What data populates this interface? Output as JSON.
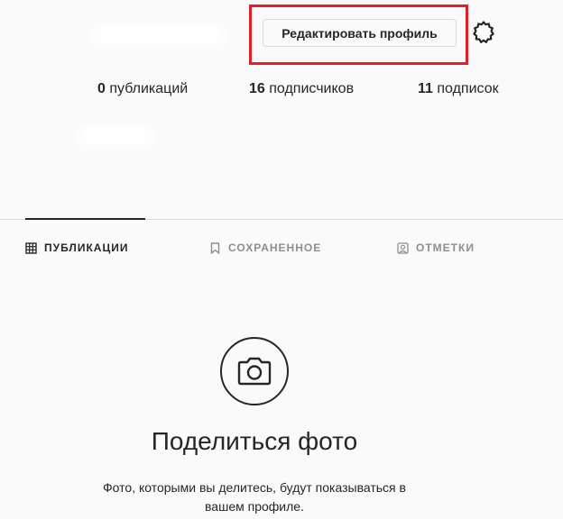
{
  "profile": {
    "edit_button_label": "Редактировать профиль",
    "settings_icon": "gear-icon",
    "stats": [
      {
        "count": "0",
        "label": "публикаций"
      },
      {
        "count": "16",
        "label": "подписчиков"
      },
      {
        "count": "11",
        "label": "подписок"
      }
    ]
  },
  "tabs": [
    {
      "label": "ПУБЛИКАЦИИ",
      "icon": "grid-icon",
      "active": true
    },
    {
      "label": "СОХРАНЕННОЕ",
      "icon": "bookmark-icon",
      "active": false
    },
    {
      "label": "ОТМЕТКИ",
      "icon": "tagged-user-icon",
      "active": false
    }
  ],
  "empty_state": {
    "icon": "camera-icon",
    "title": "Поделиться фото",
    "description_line1": "Фото, которыми вы делитесь, будут показываться в",
    "description_line2": "вашем профиле."
  },
  "colors": {
    "background": "#fafafa",
    "text": "#262626",
    "muted": "#8e8e8e",
    "border": "#dbdbdb",
    "highlight": "#e0202b"
  }
}
